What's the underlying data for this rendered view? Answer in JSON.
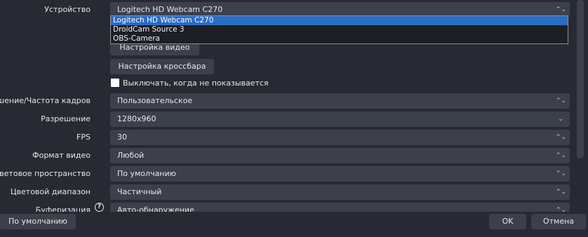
{
  "device": {
    "label": "Устройство",
    "value": "Logitech HD Webcam C270",
    "options": [
      "Logitech HD Webcam C270",
      "DroidCam Source 3",
      "OBS-Camera"
    ]
  },
  "buttons": {
    "video_settings": "Настройка видео",
    "crossbar_settings": "Настройка кроссбара"
  },
  "checkbox": {
    "label": "Выключать, когда не показывается",
    "checked": false
  },
  "fields": [
    {
      "label": "Разрешение/Частота кадров",
      "value": "Пользовательское",
      "arrow": "⌃⌄"
    },
    {
      "label": "Разрешение",
      "value": "1280x960",
      "arrow": "⌄"
    },
    {
      "label": "FPS",
      "value": "30",
      "arrow": "⌃⌄"
    },
    {
      "label": "Формат видео",
      "value": "Любой",
      "arrow": "⌃⌄"
    },
    {
      "label": "Цветовое пространство",
      "value": "По умолчанию",
      "arrow": "⌃⌄"
    },
    {
      "label": "Цветовой диапазон",
      "value": "Частичный",
      "arrow": "⌃⌄"
    },
    {
      "label": "Буферизация",
      "value": "Авто-обнаружение",
      "arrow": "⌃⌄"
    }
  ],
  "footer": {
    "defaults": "По умолчанию",
    "ok": "OK",
    "cancel": "Отмена"
  }
}
